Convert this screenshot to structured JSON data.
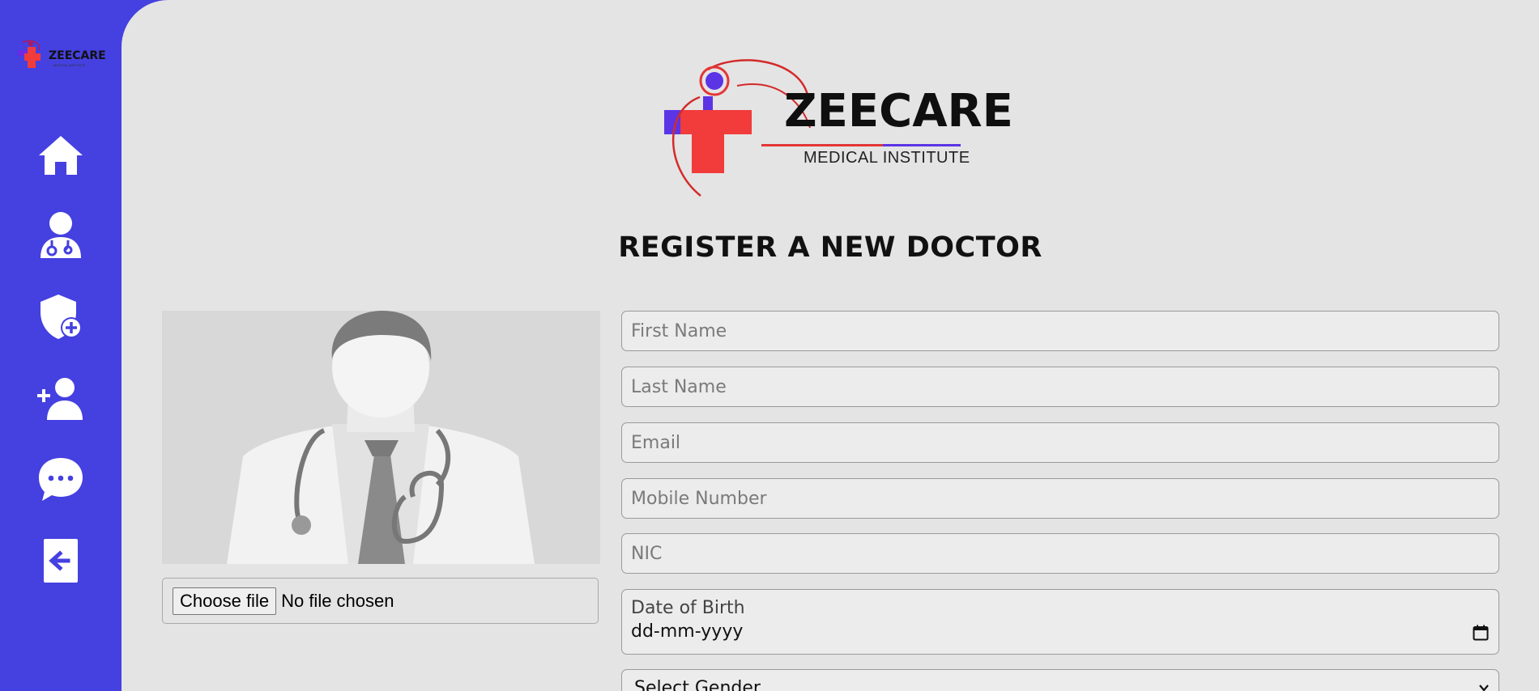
{
  "sidebar": {
    "logo_text": "ZEECARE",
    "logo_subtext": "MEDICAL INSTITUTE",
    "nav": [
      {
        "icon": "home-icon"
      },
      {
        "icon": "doctor-icon"
      },
      {
        "icon": "shield-plus-icon"
      },
      {
        "icon": "user-plus-icon"
      },
      {
        "icon": "chat-icon"
      },
      {
        "icon": "logout-icon"
      }
    ]
  },
  "brand": {
    "title": "ZEECARE",
    "subtitle": "MEDICAL INSTITUTE"
  },
  "page": {
    "heading": "REGISTER A NEW DOCTOR"
  },
  "upload": {
    "button_label": "Choose file",
    "status": "No file chosen"
  },
  "form": {
    "first_name_placeholder": "First Name",
    "last_name_placeholder": "Last Name",
    "email_placeholder": "Email",
    "mobile_placeholder": "Mobile Number",
    "nic_placeholder": "NIC",
    "dob_label": "Date of Birth",
    "dob_value": "dd-mm-yyyy",
    "gender_value": "Select Gender"
  },
  "colors": {
    "sidebar_bg": "#4540e0",
    "main_bg": "#e4e4e4",
    "brand_red": "#f23b3b",
    "brand_purple": "#5b34e6"
  }
}
